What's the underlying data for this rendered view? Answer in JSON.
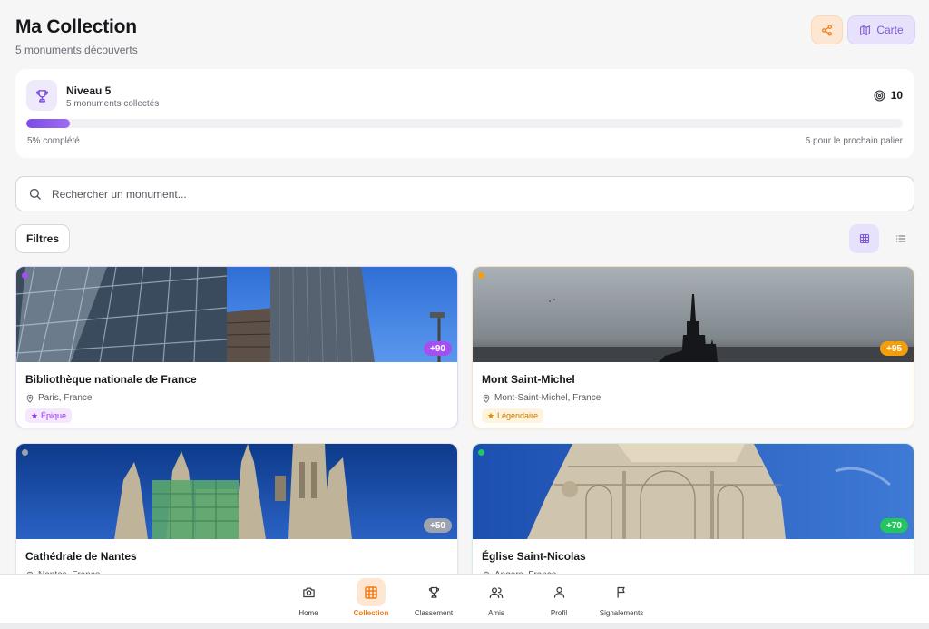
{
  "header": {
    "title": "Ma Collection",
    "subtitle": "5 monuments découverts",
    "map_label": "Carte"
  },
  "level": {
    "name": "Niveau 5",
    "sub": "5 monuments collectés",
    "points": "10",
    "progress": 0.05,
    "progress_left": "5% complété",
    "progress_right": "5 pour le prochain palier"
  },
  "search": {
    "placeholder": "Rechercher un monument..."
  },
  "filters": {
    "label": "Filtres"
  },
  "monuments": [
    {
      "name": "Bibliothèque nationale de France",
      "location": "Paris, France",
      "points": "+90",
      "rarity": "Épique",
      "color": "#a44ff0"
    },
    {
      "name": "Mont Saint-Michel",
      "location": "Mont-Saint-Michel, France",
      "points": "+95",
      "rarity": "Légendaire",
      "color": "#f59e0b"
    },
    {
      "name": "Cathédrale de Nantes",
      "location": "Nantes, France",
      "points": "+50",
      "rarity": "",
      "color": "#9ca3af"
    },
    {
      "name": "Église Saint-Nicolas",
      "location": "Angers, France",
      "points": "+70",
      "rarity": "",
      "color": "#22c55e"
    }
  ],
  "nav": {
    "items": [
      {
        "label": "Home",
        "icon": "camera-icon"
      },
      {
        "label": "Collection",
        "icon": "grid-icon"
      },
      {
        "label": "Classement",
        "icon": "trophy-icon"
      },
      {
        "label": "Amis",
        "icon": "users-icon"
      },
      {
        "label": "Profil",
        "icon": "user-icon"
      },
      {
        "label": "Signalements",
        "icon": "flag-icon"
      }
    ],
    "active": "Collection"
  },
  "colors": {
    "accent_orange": "#f07a12",
    "accent_purple": "#7c5ad8"
  }
}
